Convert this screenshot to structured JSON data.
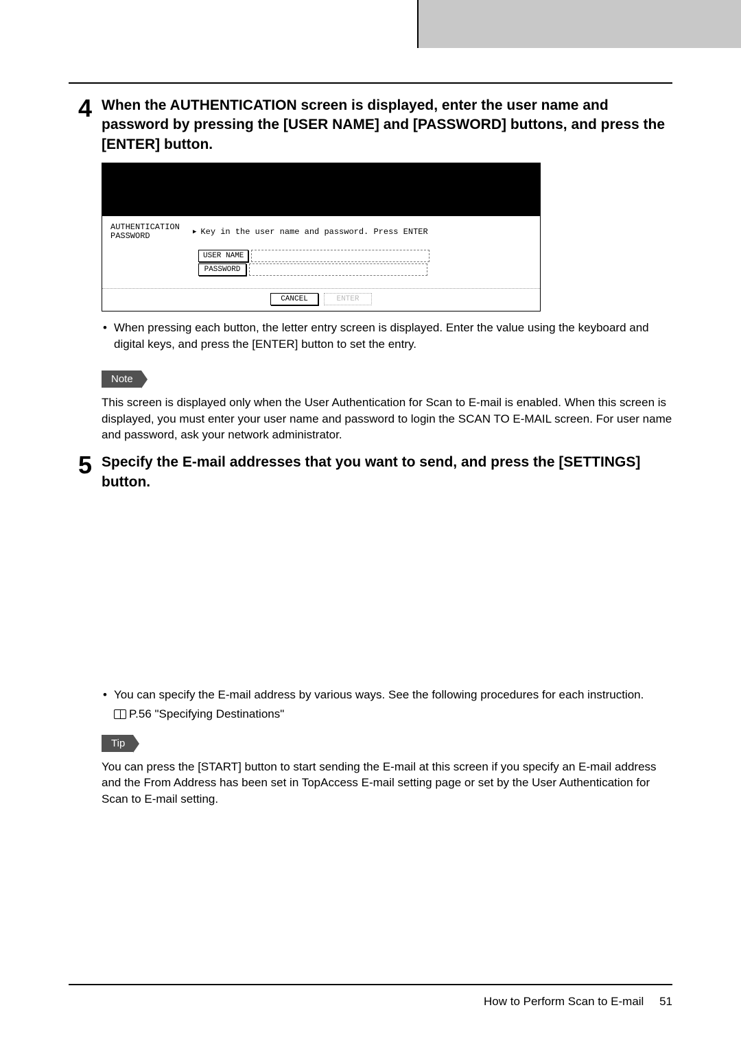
{
  "steps": {
    "s4": {
      "num": "4",
      "heading": "When the AUTHENTICATION screen is displayed, enter the user name and password by pressing the [USER NAME] and [PASSWORD] buttons, and press the [ENTER] button.",
      "auth_label": "AUTHENTICATION\nPASSWORD",
      "auth_prompt": "Key in the user name and password. Press ENTER",
      "user_name_btn": "USER NAME",
      "password_btn": "PASSWORD",
      "cancel_btn": "CANCEL",
      "enter_btn": "ENTER",
      "bullet1": "When pressing each button, the letter entry screen is displayed.  Enter the value using the keyboard and digital keys, and press the [ENTER] button to set the entry.",
      "note_label": "Note",
      "note_text": "This screen is displayed only when the User Authentication for Scan to E-mail is enabled.  When this screen is displayed, you must enter your user name and password to login the SCAN TO E-MAIL screen.  For user name and password, ask your network administrator."
    },
    "s5": {
      "num": "5",
      "heading": "Specify the E-mail addresses that you want to send, and press the [SETTINGS] button.",
      "bullet1": "You can specify the E-mail address by various ways.  See the following procedures for each instruction.",
      "ref": "P.56 \"Specifying Destinations\"",
      "tip_label": "Tip",
      "tip_text": "You can press the [START] button to start sending the E-mail at this screen if you specify an E-mail address and the From Address has been set in TopAccess E-mail setting page or set by the User Authentication for Scan to E-mail setting."
    }
  },
  "footer": {
    "title": "How to Perform Scan to E-mail",
    "page": "51"
  }
}
